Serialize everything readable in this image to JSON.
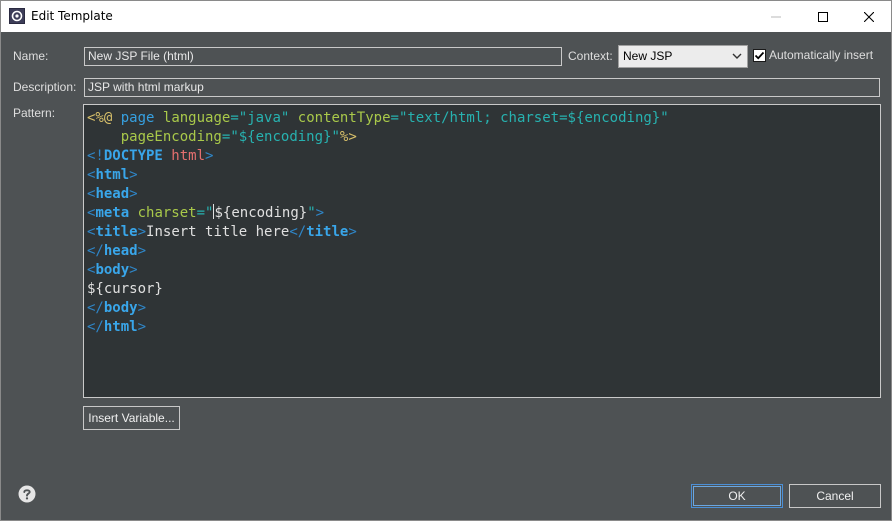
{
  "window": {
    "title": "Edit Template",
    "controls": [
      "minimize-icon",
      "maximize-icon",
      "close-icon"
    ]
  },
  "form": {
    "name_label": "Name:",
    "name_value": "New JSP File (html)",
    "context_label": "Context:",
    "context_value": "New JSP",
    "auto_insert_label": "Automatically insert",
    "auto_insert_checked": true,
    "description_label": "Description:",
    "description_value": "JSP with html markup",
    "pattern_label": "Pattern:"
  },
  "pattern_lines": [
    "<%@ page language=\"java\" contentType=\"text/html; charset=${encoding}\"",
    "    pageEncoding=\"${encoding}\"%>",
    "<!DOCTYPE html>",
    "<html>",
    "<head>",
    "<meta charset=\"${encoding}\">",
    "<title>Insert title here</title>",
    "</head>",
    "<body>",
    "${cursor}",
    "</body>",
    "</html>"
  ],
  "buttons": {
    "insert_variable": "Insert Variable...",
    "ok": "OK",
    "cancel": "Cancel"
  },
  "colors": {
    "background": "#4e5254",
    "editor_background": "#2f3436",
    "tag": "#39a6ea",
    "attribute": "#a9c94a",
    "value": "#27b2b0",
    "directive": "#d8c06a",
    "doctype": "#e56f6f",
    "ok_border": "#4b8fd6"
  }
}
